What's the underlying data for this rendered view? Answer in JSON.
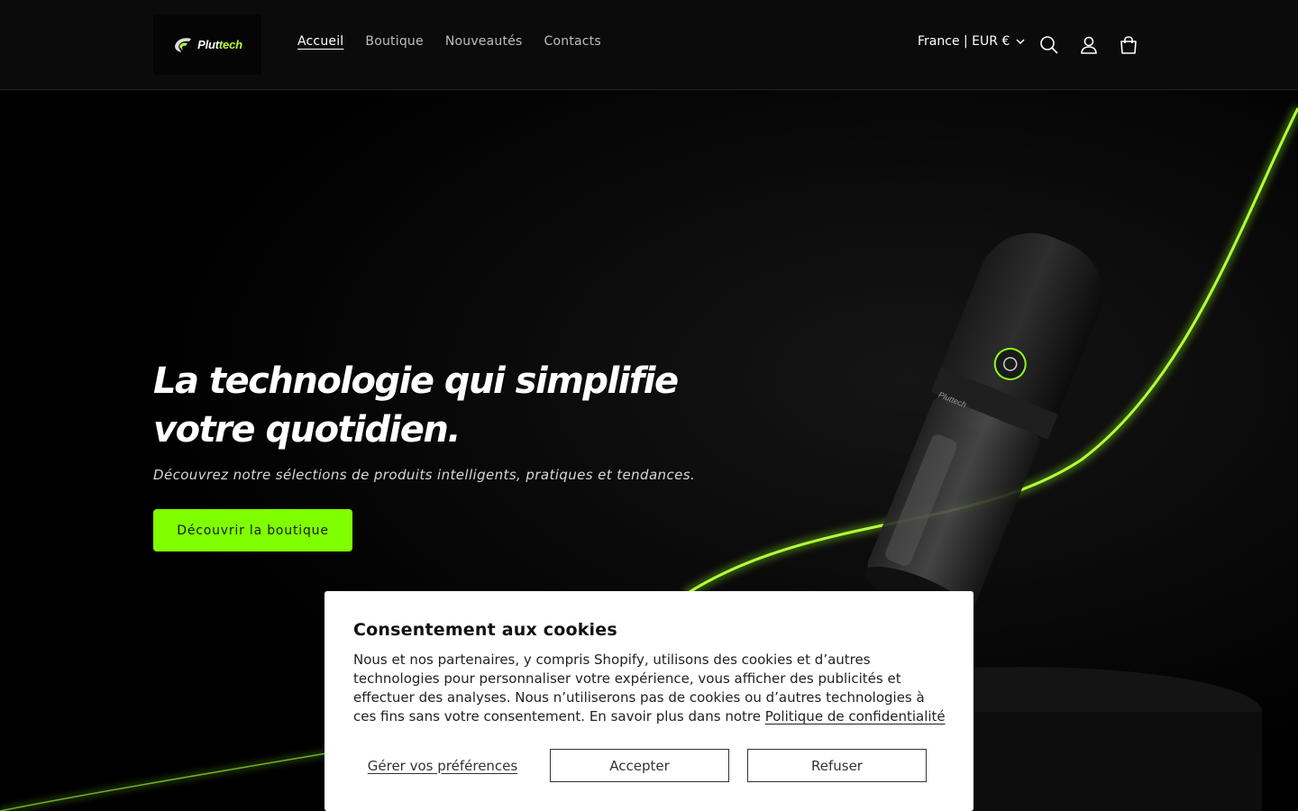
{
  "header": {
    "logo": {
      "text_main": "Plut",
      "text_accent": "tech"
    },
    "nav": [
      {
        "label": "Accueil",
        "active": true
      },
      {
        "label": "Boutique",
        "active": false
      },
      {
        "label": "Nouveautés",
        "active": false
      },
      {
        "label": "Contacts",
        "active": false
      }
    ],
    "locale_label": "France | EUR €",
    "icons": [
      "search-icon",
      "account-icon",
      "cart-icon"
    ]
  },
  "hero": {
    "title": "La technologie qui simplifie votre quotidien.",
    "subtitle": "Découvrez notre sélections de produits intelligents, pratiques et tendances.",
    "cta_label": "Découvrir la boutique",
    "product_brand": "Pluttech"
  },
  "cookie_banner": {
    "title": "Consentement aux cookies",
    "body": "Nous et nos partenaires, y compris Shopify, utilisons des cookies et d’autres technologies pour personnaliser votre expérience, vous afficher des publicités et effectuer des analyses. Nous n’utiliserons pas de cookies ou d’autres technologies à ces fins sans votre consentement. En savoir plus dans notre ",
    "privacy_link": "Politique de confidentialité",
    "manage_label": "Gérer vos préférences",
    "accept_label": "Accepter",
    "decline_label": "Refuser"
  },
  "colors": {
    "accent": "#7fff00",
    "header_bg": "#0b0b0b",
    "hero_bg": "#000000",
    "banner_bg": "#ffffff"
  }
}
